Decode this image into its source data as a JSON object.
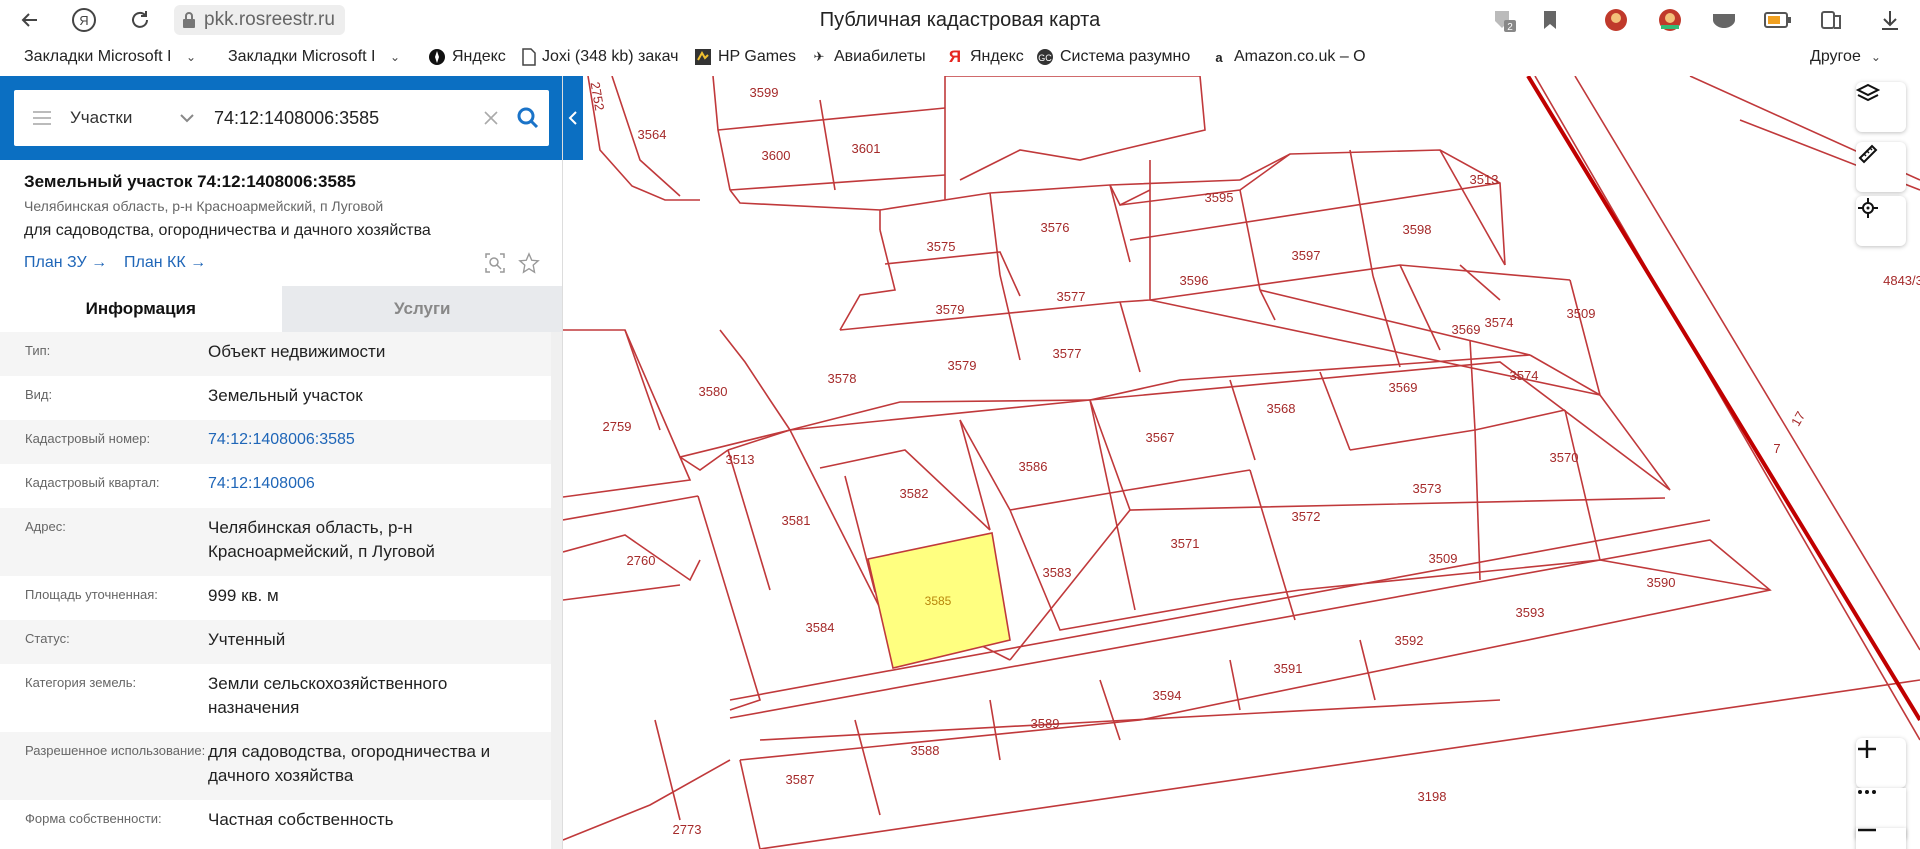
{
  "browser": {
    "url": "pkk.rosreestr.ru",
    "title": "Публичная кадастровая карта",
    "ext_badge": "2",
    "bookmarks": [
      {
        "label": "Закладки Microsoft I",
        "type": "folder"
      },
      {
        "label": "Закладки Microsoft I",
        "type": "folder"
      },
      {
        "label": "Яндекс",
        "type": "link"
      },
      {
        "label": "Joxi (348 kb) закач",
        "type": "link"
      },
      {
        "label": "HP Games",
        "type": "link"
      },
      {
        "label": "Авиабилеты",
        "type": "link"
      },
      {
        "label": "Яндекс",
        "type": "link"
      },
      {
        "label": "Система разумно",
        "type": "link"
      },
      {
        "label": "Amazon.co.uk – O",
        "type": "link"
      }
    ],
    "other_bookmarks": "Другое"
  },
  "search": {
    "category": "Участки",
    "query": "74:12:1408006:3585"
  },
  "object": {
    "title": "Земельный участок 74:12:1408006:3585",
    "address_short": "Челябинская область, р-н Красноармейский, п Луговой",
    "use": "для садоводства, огородничества и дачного хозяйства",
    "plan_zu": "План ЗУ",
    "plan_kk": "План КК"
  },
  "tabs": [
    {
      "label": "Информация",
      "active": true
    },
    {
      "label": "Услуги",
      "active": false
    }
  ],
  "info_rows": [
    {
      "label": "Тип:",
      "value": "Объект недвижимости",
      "link": false
    },
    {
      "label": "Вид:",
      "value": "Земельный участок",
      "link": false
    },
    {
      "label": "Кадастровый номер:",
      "value": "74:12:1408006:3585",
      "link": true
    },
    {
      "label": "Кадастровый квартал:",
      "value": "74:12:1408006",
      "link": true
    },
    {
      "label": "Адрес:",
      "value": "Челябинская область, р-н Красноармейский, п Луговой",
      "link": false
    },
    {
      "label": "Площадь уточненная:",
      "value": "999 кв. м",
      "link": false
    },
    {
      "label": "Статус:",
      "value": "Учтенный",
      "link": false
    },
    {
      "label": "Категория земель:",
      "value": "Земли сельскохозяйственного назначения",
      "link": false
    },
    {
      "label": "Разрешенное использование:",
      "value": "для садоводства, огородничества и дачного хозяйства",
      "link": false
    },
    {
      "label": "Форма собственности:",
      "value": "Частная собственность",
      "link": false
    }
  ],
  "map": {
    "colors": {
      "parcel_line": "#c0393b",
      "selected_fill": "#ffff80",
      "boundary": "#c00000",
      "label": "#a52a2a"
    },
    "labels": [
      "3599",
      "3600",
      "3601",
      "3564",
      "2752",
      "3595",
      "3513",
      "3576",
      "3575",
      "3596",
      "3597",
      "3598",
      "3579",
      "3577",
      "3579",
      "3577",
      "3569",
      "3574",
      "3509",
      "4843/3",
      "3580",
      "3578",
      "3574",
      "3569",
      "3568",
      "3567",
      "2759",
      "3513",
      "3586",
      "3582",
      "3581",
      "3570",
      "3573",
      "3572",
      "3571",
      "2760",
      "3509",
      "3583",
      "3585",
      "3584",
      "3590",
      "3593",
      "3592",
      "3591",
      "3594",
      "3589",
      "3588",
      "3587",
      "3198",
      "2773",
      "17",
      "7"
    ],
    "map_controls": [
      "layers",
      "ruler",
      "locate",
      "zoom-in",
      "more",
      "zoom-out"
    ]
  }
}
